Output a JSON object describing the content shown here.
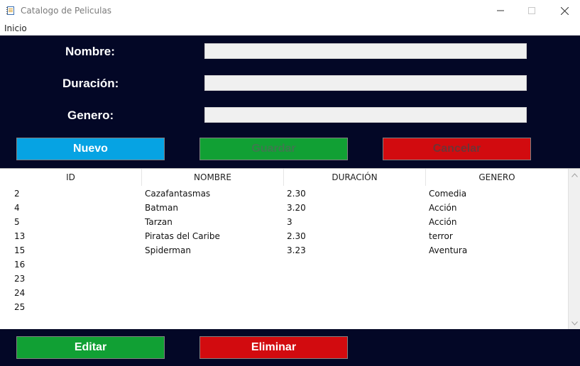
{
  "window": {
    "title": "Catalogo de Peliculas",
    "icon": "notebook-icon"
  },
  "menu": {
    "items": [
      {
        "label": "Inicio"
      }
    ]
  },
  "form": {
    "labels": {
      "nombre": "Nombre:",
      "duracion": "Duración:",
      "genero": "Genero:"
    },
    "fields": {
      "nombre": "",
      "duracion": "",
      "genero": ""
    },
    "buttons": {
      "nuevo": "Nuevo",
      "guardar": "Guardar",
      "cancelar": "Cancelar"
    }
  },
  "table": {
    "columns": [
      "ID",
      "NOMBRE",
      "DURACIÓN",
      "GENERO"
    ],
    "rows": [
      {
        "id": "2",
        "nombre": "Cazafantasmas",
        "duracion": "2.30",
        "genero": "Comedia"
      },
      {
        "id": "4",
        "nombre": "Batman",
        "duracion": "3.20",
        "genero": "Acción"
      },
      {
        "id": "5",
        "nombre": "Tarzan",
        "duracion": "3",
        "genero": "Acción"
      },
      {
        "id": "13",
        "nombre": "Piratas del Caribe",
        "duracion": "2.30",
        "genero": "terror"
      },
      {
        "id": "15",
        "nombre": "Spiderman",
        "duracion": "3.23",
        "genero": "Aventura"
      },
      {
        "id": "16",
        "nombre": "",
        "duracion": "",
        "genero": ""
      },
      {
        "id": "23",
        "nombre": "",
        "duracion": "",
        "genero": ""
      },
      {
        "id": "24",
        "nombre": "",
        "duracion": "",
        "genero": ""
      },
      {
        "id": "25",
        "nombre": "",
        "duracion": "",
        "genero": ""
      }
    ]
  },
  "actions": {
    "editar": "Editar",
    "eliminar": "Eliminar"
  },
  "colors": {
    "panel_bg": "#030726",
    "nuevo": "#06a3e3",
    "green": "#11a034",
    "red": "#d20b0f"
  }
}
